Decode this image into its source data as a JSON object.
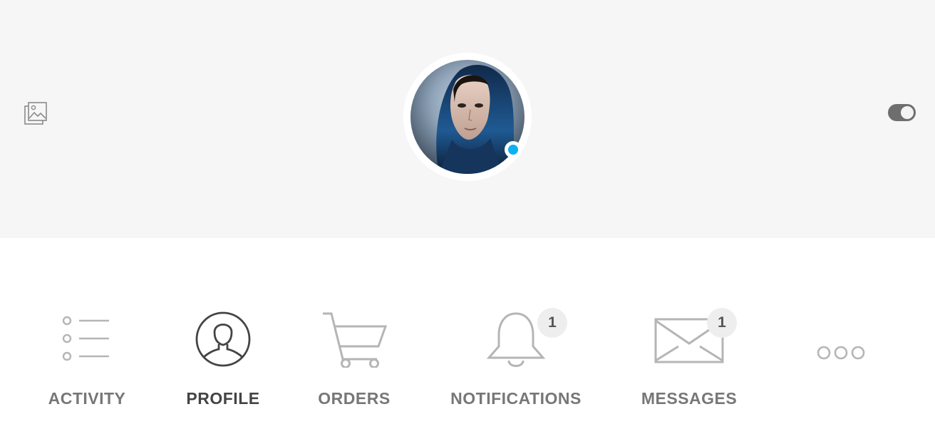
{
  "header": {
    "toggle_on": true,
    "icons": {
      "cover_photo": "image-stack-icon",
      "toggle": "toggle-switch-icon"
    }
  },
  "profile": {
    "avatar_icon": "avatar",
    "online_status": "online",
    "status_color": "#0cb1f3"
  },
  "nav": {
    "active": "profile",
    "items": [
      {
        "id": "activity",
        "label": "ACTIVITY",
        "icon": "list-icon"
      },
      {
        "id": "profile",
        "label": "PROFILE",
        "icon": "user-circle-icon"
      },
      {
        "id": "orders",
        "label": "ORDERS",
        "icon": "cart-icon"
      },
      {
        "id": "notifications",
        "label": "NOTIFICATIONS",
        "icon": "bell-icon",
        "badge": "1"
      },
      {
        "id": "messages",
        "label": "MESSAGES",
        "icon": "envelope-icon",
        "badge": "1"
      },
      {
        "id": "more",
        "label": "",
        "icon": "more-dots-icon"
      }
    ]
  },
  "colors": {
    "cover_bg": "#f6f6f6",
    "label": "#777777",
    "label_active": "#444444",
    "icon_inactive": "#b5b5b5",
    "icon_active": "#444444",
    "badge_bg": "#eeeeee"
  }
}
